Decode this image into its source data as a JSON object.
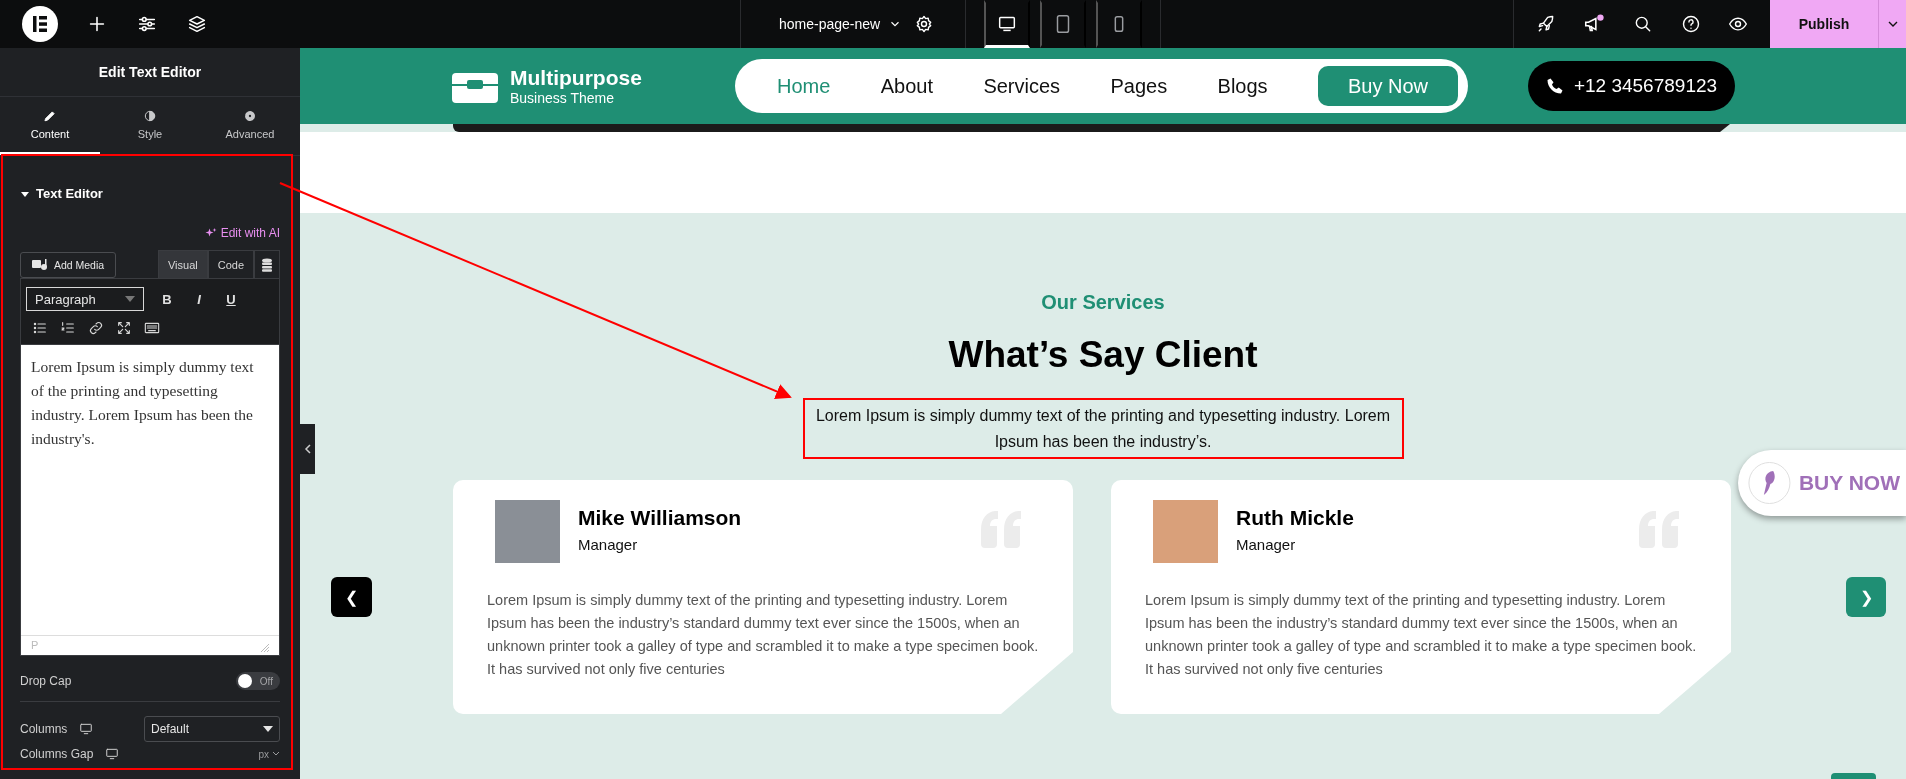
{
  "topbar": {
    "page_name": "home-page-new",
    "devices": [
      {
        "kind": "desktop",
        "selected": true
      },
      {
        "kind": "tablet",
        "selected": false
      },
      {
        "kind": "mobile",
        "selected": false
      }
    ],
    "notification": true,
    "publish": "Publish"
  },
  "panel": {
    "title": "Edit Text Editor",
    "tabs": [
      {
        "kind": "content",
        "label": "Content",
        "selected": true
      },
      {
        "kind": "style",
        "label": "Style",
        "selected": false
      },
      {
        "kind": "advanced",
        "label": "Advanced",
        "selected": false
      }
    ],
    "section": {
      "title": "Text Editor",
      "expanded": true
    },
    "ai_link": "Edit with AI",
    "add_media": "Add Media",
    "editor_tabs": [
      {
        "label": "Visual",
        "selected": true
      },
      {
        "label": "Code",
        "selected": false
      }
    ],
    "format": "Paragraph",
    "format_buttons": [
      "B",
      "I",
      "U"
    ],
    "editor_text": "Lorem Ipsum is simply dummy text of the printing and typesetting industry. Lorem Ipsum has been the industry's.",
    "path": "P",
    "drop_cap": {
      "label": "Drop Cap",
      "on": false,
      "state_text": "Off"
    },
    "columns": {
      "label": "Columns",
      "value": "Default"
    },
    "columns_gap": {
      "label": "Columns Gap",
      "unit": "px"
    }
  },
  "site": {
    "logo_title": "Multipurpose",
    "logo_subtitle": "Business Theme",
    "nav": [
      {
        "label": "Home",
        "selected": true
      },
      {
        "label": "About",
        "selected": false
      },
      {
        "label": "Services",
        "selected": false
      },
      {
        "label": "Pages",
        "selected": false
      },
      {
        "label": "Blogs",
        "selected": false
      }
    ],
    "cta": "Buy Now",
    "phone": "+12 3456789123"
  },
  "section": {
    "eyebrow": "Our Services",
    "heading": "What’s Say Client",
    "text": "Lorem Ipsum is simply dummy text of the printing and typesetting industry. Lorem Ipsum has been the industry’s.",
    "prev": "❮",
    "next": "❯"
  },
  "testimonials": [
    {
      "name": "Mike Williamson",
      "role": "Manager",
      "text": "Lorem Ipsum is simply dummy text of the printing and typesetting industry. Lorem Ipsum has been the industry’s standard dummy text ever since the 1500s, when an unknown printer took a galley of type and scrambled it to make a type specimen book. It has survived not only five centuries"
    },
    {
      "name": "Ruth Mickle",
      "role": "Manager",
      "text": "Lorem Ipsum is simply dummy text of the printing and typesetting industry. Lorem Ipsum has been the industry’s standard dummy text ever since the 1500s, when an unknown printer took a galley of type and scrambled it to make a type specimen book. It has survived not only five centuries"
    }
  ],
  "float_button": "BUY NOW"
}
